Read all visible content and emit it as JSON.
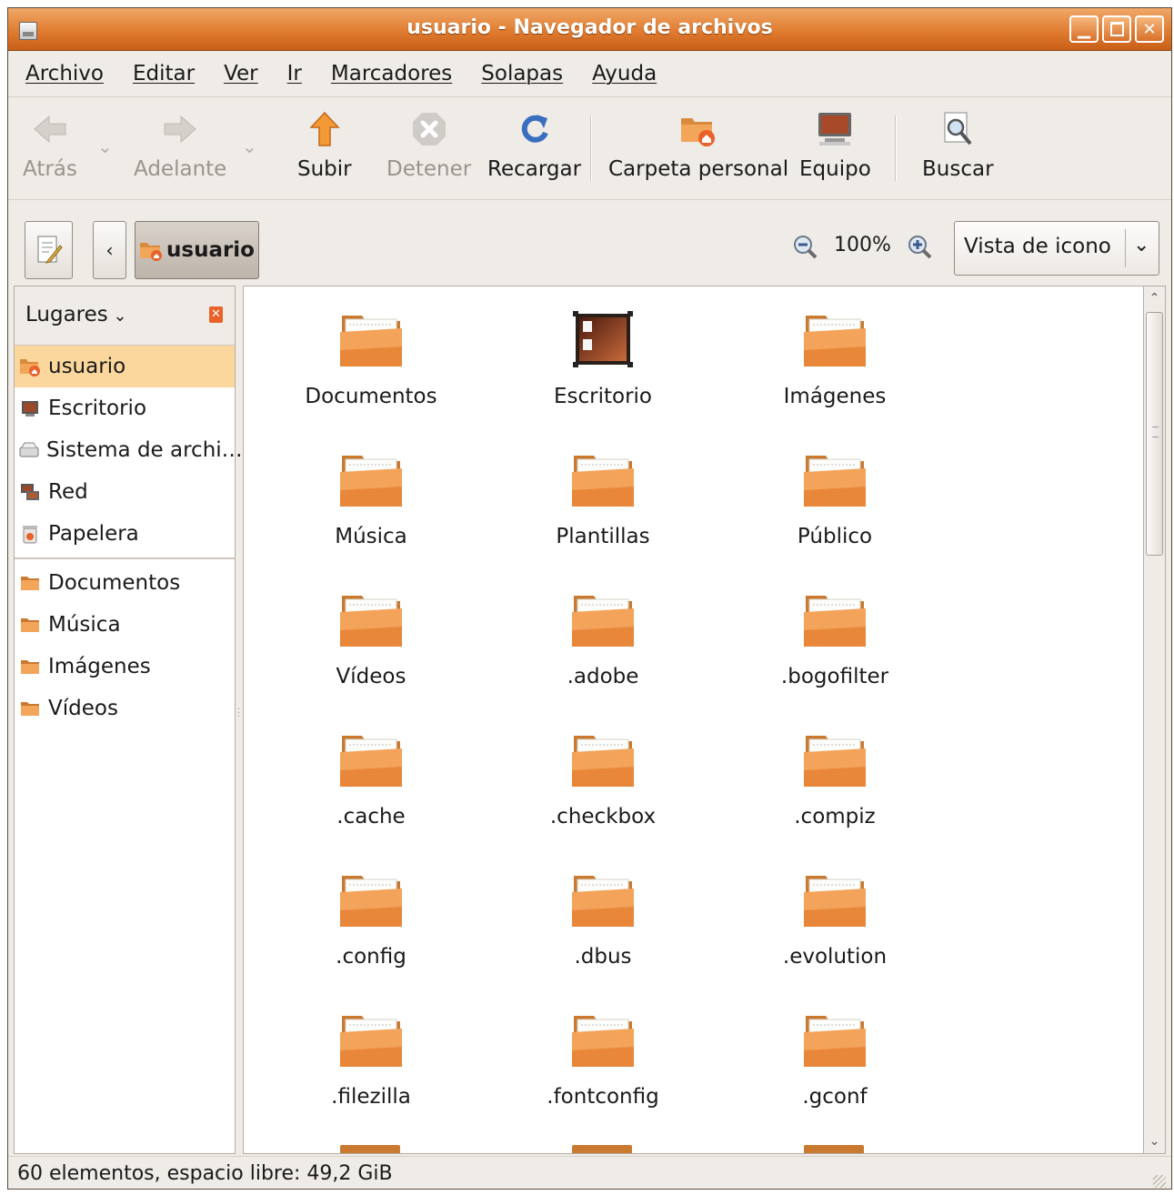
{
  "window": {
    "title": "usuario - Navegador de archivos",
    "controls": [
      "minimize",
      "maximize",
      "close"
    ]
  },
  "menu": [
    "Archivo",
    "Editar",
    "Ver",
    "Ir",
    "Marcadores",
    "Solapas",
    "Ayuda"
  ],
  "toolbar": {
    "back": "Atrás",
    "forward": "Adelante",
    "up": "Subir",
    "stop": "Detener",
    "reload": "Recargar",
    "home": "Carpeta personal",
    "computer": "Equipo",
    "search": "Buscar"
  },
  "location": {
    "breadcrumb": "usuario",
    "zoom": "100%",
    "view_mode": "Vista de icono"
  },
  "sidebar": {
    "title": "Lugares",
    "places": [
      {
        "label": "usuario",
        "icon": "home-folder-icon",
        "selected": true
      },
      {
        "label": "Escritorio",
        "icon": "desktop-icon"
      },
      {
        "label": "Sistema de archi…",
        "icon": "drive-icon"
      },
      {
        "label": "Red",
        "icon": "network-icon"
      },
      {
        "label": "Papelera",
        "icon": "trash-icon"
      }
    ],
    "bookmarks": [
      {
        "label": "Documentos",
        "icon": "folder-icon"
      },
      {
        "label": "Música",
        "icon": "folder-icon"
      },
      {
        "label": "Imágenes",
        "icon": "folder-icon"
      },
      {
        "label": "Vídeos",
        "icon": "folder-icon"
      }
    ]
  },
  "files": [
    {
      "name": "Documentos",
      "icon": "folder-icon"
    },
    {
      "name": "Escritorio",
      "icon": "desktop-folder-icon"
    },
    {
      "name": "Imágenes",
      "icon": "folder-icon"
    },
    {
      "name": "Música",
      "icon": "folder-icon"
    },
    {
      "name": "Plantillas",
      "icon": "folder-icon"
    },
    {
      "name": "Público",
      "icon": "folder-icon"
    },
    {
      "name": "Vídeos",
      "icon": "folder-icon"
    },
    {
      "name": ".adobe",
      "icon": "folder-icon"
    },
    {
      "name": ".bogofilter",
      "icon": "folder-icon"
    },
    {
      "name": ".cache",
      "icon": "folder-icon"
    },
    {
      "name": ".checkbox",
      "icon": "folder-icon"
    },
    {
      "name": ".compiz",
      "icon": "folder-icon"
    },
    {
      "name": ".config",
      "icon": "folder-icon"
    },
    {
      "name": ".dbus",
      "icon": "folder-icon"
    },
    {
      "name": ".evolution",
      "icon": "folder-icon"
    },
    {
      "name": ".filezilla",
      "icon": "folder-icon"
    },
    {
      "name": ".fontconfig",
      "icon": "folder-icon"
    },
    {
      "name": ".gconf",
      "icon": "folder-icon"
    }
  ],
  "status": "60 elementos, espacio libre: 49,2 GiB",
  "colors": {
    "titlebar": "#e07c30",
    "folder": "#f0923e",
    "selection": "#fbd79d",
    "window_bg": "#efebe7"
  }
}
